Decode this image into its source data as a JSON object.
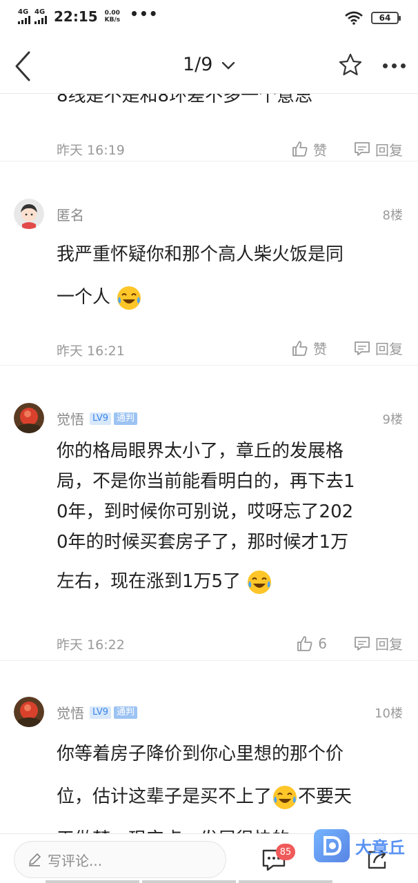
{
  "status_bar": {
    "network1": "4G",
    "network2": "4G",
    "time": "22:15",
    "speed_value": "0.00",
    "speed_unit": "KB/s",
    "more": "•••",
    "battery": "64"
  },
  "nav": {
    "page_indicator": "1/9"
  },
  "comments": [
    {
      "partial_text": "8线是不是和8环差不多一个意思",
      "time": "昨天 16:19",
      "like_label": "赞",
      "reply_label": "回复"
    },
    {
      "name": "匿名",
      "floor": "8楼",
      "text_1": "我严重怀疑你和那个高人柴火饭是同",
      "text_2": "一个人",
      "time": "昨天 16:21",
      "like_label": "赞",
      "reply_label": "回复"
    },
    {
      "name": "觉悟",
      "level": "LV9",
      "role": "通判",
      "floor": "9楼",
      "text_1": "你的格局眼界太小了，章丘的发展格",
      "text_2": "局，不是你当前能看明白的，再下去1",
      "text_3": "0年，到时候你可别说，哎呀忘了202",
      "text_4": "0年的时候买套房子了，那时候才1万",
      "text_5": "左右，现在涨到1万5了",
      "time": "昨天 16:22",
      "like_count": "6",
      "reply_label": "回复"
    },
    {
      "name": "觉悟",
      "level": "LV9",
      "role": "通判",
      "floor": "10楼",
      "text_1": "你等着房子降价到你心里想的那个价",
      "text_2": "位，估计这辈子是买不上了",
      "text_2b": "不要天",
      "text_3": "天做梦，现实点，发展很快的……"
    }
  ],
  "bottom": {
    "placeholder": "写评论...",
    "comment_badge": "85",
    "watermark": "大章丘"
  },
  "colors": {
    "accent_blue": "#3a85e8",
    "badge_red": "#f05a5a",
    "muted_text": "#999999"
  }
}
